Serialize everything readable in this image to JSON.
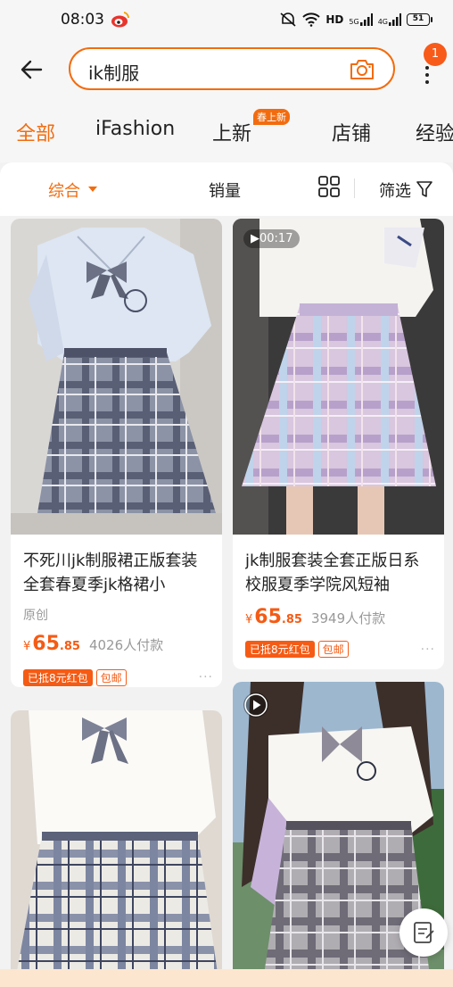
{
  "status_bar": {
    "time": "08:03",
    "network": "HD",
    "sig5g": "5G",
    "sig4g": "4G",
    "battery": "51"
  },
  "search": {
    "query": "ik制服",
    "notification_count": "1"
  },
  "tabs": [
    {
      "label": "全部",
      "active": true
    },
    {
      "label": "iFashion",
      "active": false
    },
    {
      "label": "上新",
      "active": false
    },
    {
      "label": "店铺",
      "active": false
    },
    {
      "label": "经验",
      "active": false
    }
  ],
  "tab_badge": "春上新",
  "filters": {
    "sort": "综合",
    "sales": "销量",
    "filter": "筛选"
  },
  "products": [
    {
      "title": "不死川jk制服裙正版套装全套春夏季jk格裙小",
      "brand": "原创",
      "currency": "¥",
      "price_int": "65",
      "price_dec": ".85",
      "sold": "4026人付款",
      "tag_coupon": "已抵8元红包",
      "tag_shipping": "包邮"
    },
    {
      "title": "jk制服套装全套正版日系校服夏季学院风短袖",
      "currency": "¥",
      "price_int": "65",
      "price_dec": ".85",
      "sold": "3949人付款",
      "tag_coupon": "已抵8元红包",
      "tag_shipping": "包邮",
      "video_time": "00:17"
    }
  ],
  "more_dots": "···"
}
